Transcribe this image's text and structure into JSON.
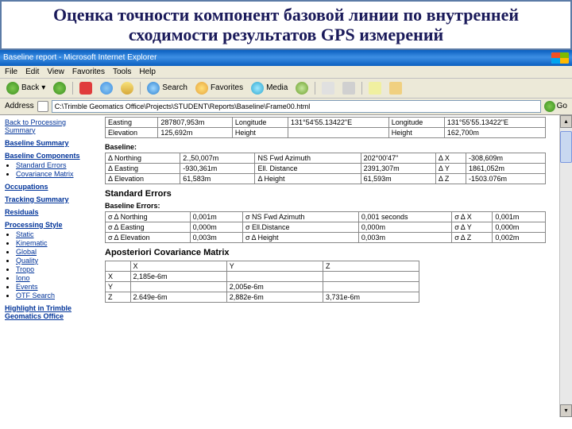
{
  "slide": {
    "title": "Оценка точности компонент базовой линии по внутренней сходимости результатов GPS измерений"
  },
  "window": {
    "title": "Baseline report - Microsoft Internet Explorer"
  },
  "menu": {
    "file": "File",
    "edit": "Edit",
    "view": "View",
    "favorites": "Favorites",
    "tools": "Tools",
    "help": "Help"
  },
  "toolbar": {
    "back": "Back",
    "search": "Search",
    "favorites": "Favorites",
    "media": "Media"
  },
  "addr": {
    "label": "Address",
    "value": "C:\\Trimble Geomatics Office\\Projects\\STUDENT\\Reports\\Baseline\\Frame00.html",
    "go": "Go"
  },
  "sidebar": {
    "back": "Back to Processing Summary",
    "bs": "Baseline Summary",
    "bc": "Baseline Components",
    "bc_items": [
      "Standard Errors",
      "Covariance Matrix"
    ],
    "occ": "Occupations",
    "ts": "Tracking Summary",
    "res": "Residuals",
    "ps": "Processing Style",
    "ps_items": [
      "Static",
      "Kinematic",
      "Global",
      "Quality",
      "Tropo",
      "Iono",
      "Events",
      "OTF Search"
    ],
    "hl": "Highlight in Trimble Geomatics Office"
  },
  "top_table": {
    "r1c1": "Easting",
    "r1c2": "287807,953m",
    "r1c3": "Longitude",
    "r1c4": "131°54'55.13422\"E",
    "r1c5": "Longitude",
    "r1c6": "131°55'55.13422\"E",
    "r2c1": "Elevation",
    "r2c2": "125,692m",
    "r2c3": "Height",
    "r2c4": "",
    "r2c5": "Height",
    "r2c6": "162,700m"
  },
  "baseline": {
    "label": "Baseline:",
    "r1c1": "Δ Northing",
    "r1c2": "2.,50,007m",
    "r1c3": "NS Fwd Azimuth",
    "r1c4": "202°00'47\"",
    "r1c5": "Δ X",
    "r1c6": "-308,609m",
    "r2c1": "Δ Easting",
    "r2c2": "-930,361m",
    "r2c3": "Ell. Distance",
    "r2c4": "2391,307m",
    "r2c5": "Δ Y",
    "r2c6": "1861,052m",
    "r3c1": "Δ Elevation",
    "r3c2": "61,583m",
    "r3c3": "Δ Height",
    "r3c4": "61,593m",
    "r3c5": "Δ Z",
    "r3c6": "-1503.076m"
  },
  "se": {
    "label": "Standard Errors",
    "sub": "Baseline Errors:",
    "r1c1": "σ Δ Northing",
    "r1c2": "0,001m",
    "r1c3": "σ NS Fwd Azimuth",
    "r1c4": "0,001 seconds",
    "r1c5": "σ Δ X",
    "r1c6": "0,001m",
    "r2c1": "σ Δ Easting",
    "r2c2": "0,000m",
    "r2c3": "σ Ell.Distance",
    "r2c4": "0,000m",
    "r2c5": "σ Δ Y",
    "r2c6": "0,000m",
    "r3c1": "σ Δ Elevation",
    "r3c2": "0,003m",
    "r3c3": "σ Δ Height",
    "r3c4": "0,003m",
    "r3c5": "σ Δ Z",
    "r3c6": "0,002m"
  },
  "cov": {
    "label": "Aposteriori Covariance Matrix",
    "hx": "X",
    "hy": "Y",
    "hz": "Z",
    "rx": "X",
    "ry": "Y",
    "rz": "Z",
    "xx": "2,185e-6m",
    "yx": "",
    "yy": "2,005e-6m",
    "zx": "2.649e-6m",
    "zy": "2,882e-6m",
    "zz": "3,731e-6m"
  }
}
